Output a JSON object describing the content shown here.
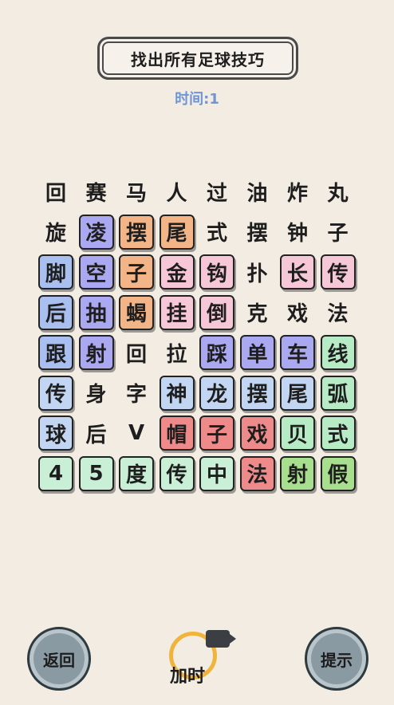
{
  "title": "找出所有足球技巧",
  "timer": "时间:1",
  "buttons": {
    "back": "返回",
    "add_time": "加时",
    "hint": "提示"
  },
  "grid": [
    [
      {
        "t": "回",
        "c": ""
      },
      {
        "t": "赛",
        "c": ""
      },
      {
        "t": "马",
        "c": ""
      },
      {
        "t": "人",
        "c": ""
      },
      {
        "t": "过",
        "c": ""
      },
      {
        "t": "油",
        "c": ""
      },
      {
        "t": "炸",
        "c": ""
      },
      {
        "t": "丸",
        "c": ""
      }
    ],
    [
      {
        "t": "旋",
        "c": ""
      },
      {
        "t": "凌",
        "c": "purple"
      },
      {
        "t": "摆",
        "c": "orange"
      },
      {
        "t": "尾",
        "c": "orange"
      },
      {
        "t": "式",
        "c": ""
      },
      {
        "t": "摆",
        "c": ""
      },
      {
        "t": "钟",
        "c": ""
      },
      {
        "t": "子",
        "c": ""
      }
    ],
    [
      {
        "t": "脚",
        "c": "blue"
      },
      {
        "t": "空",
        "c": "purple"
      },
      {
        "t": "子",
        "c": "orange"
      },
      {
        "t": "金",
        "c": "pink"
      },
      {
        "t": "钩",
        "c": "pink"
      },
      {
        "t": "扑",
        "c": ""
      },
      {
        "t": "长",
        "c": "pink"
      },
      {
        "t": "传",
        "c": "pink"
      }
    ],
    [
      {
        "t": "后",
        "c": "blue"
      },
      {
        "t": "抽",
        "c": "purple"
      },
      {
        "t": "蝎",
        "c": "orange"
      },
      {
        "t": "挂",
        "c": "pink"
      },
      {
        "t": "倒",
        "c": "pink"
      },
      {
        "t": "克",
        "c": ""
      },
      {
        "t": "戏",
        "c": ""
      },
      {
        "t": "法",
        "c": ""
      }
    ],
    [
      {
        "t": "跟",
        "c": "blue"
      },
      {
        "t": "射",
        "c": "purple"
      },
      {
        "t": "回",
        "c": ""
      },
      {
        "t": "拉",
        "c": ""
      },
      {
        "t": "踩",
        "c": "purple"
      },
      {
        "t": "单",
        "c": "purple"
      },
      {
        "t": "车",
        "c": "purple"
      },
      {
        "t": "线",
        "c": "green"
      }
    ],
    [
      {
        "t": "传",
        "c": "lblue"
      },
      {
        "t": "身",
        "c": ""
      },
      {
        "t": "字",
        "c": ""
      },
      {
        "t": "神",
        "c": "lblue"
      },
      {
        "t": "龙",
        "c": "lblue"
      },
      {
        "t": "摆",
        "c": "lblue"
      },
      {
        "t": "尾",
        "c": "lblue"
      },
      {
        "t": "弧",
        "c": "green"
      }
    ],
    [
      {
        "t": "球",
        "c": "lblue"
      },
      {
        "t": "后",
        "c": ""
      },
      {
        "t": "V",
        "c": ""
      },
      {
        "t": "帽",
        "c": "red"
      },
      {
        "t": "子",
        "c": "red"
      },
      {
        "t": "戏",
        "c": "red"
      },
      {
        "t": "贝",
        "c": "green"
      },
      {
        "t": "式",
        "c": "green"
      }
    ],
    [
      {
        "t": "4",
        "c": "mint"
      },
      {
        "t": "5",
        "c": "mint"
      },
      {
        "t": "度",
        "c": "mint"
      },
      {
        "t": "传",
        "c": "mint"
      },
      {
        "t": "中",
        "c": "mint"
      },
      {
        "t": "法",
        "c": "red"
      },
      {
        "t": "射",
        "c": "lime"
      },
      {
        "t": "假",
        "c": "lime"
      }
    ]
  ]
}
